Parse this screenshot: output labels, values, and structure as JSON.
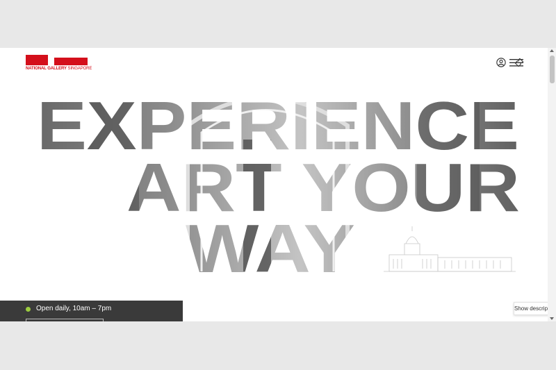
{
  "logo": {
    "brand_bold": "NATIONAL GALLERY",
    "brand_light": " SINGAPORE",
    "color": "#d40f1b"
  },
  "header": {
    "icons": [
      "user-icon",
      "ticket-icon",
      "hamburger-menu-icon"
    ]
  },
  "hero": {
    "lines": [
      "EXPERIENCE",
      "ART YOUR",
      "WAY"
    ]
  },
  "status": {
    "hours": "Open daily, 10am – 7pm",
    "indicator_color": "#9ccc3f"
  },
  "description_toggle": {
    "label": "Show description"
  }
}
